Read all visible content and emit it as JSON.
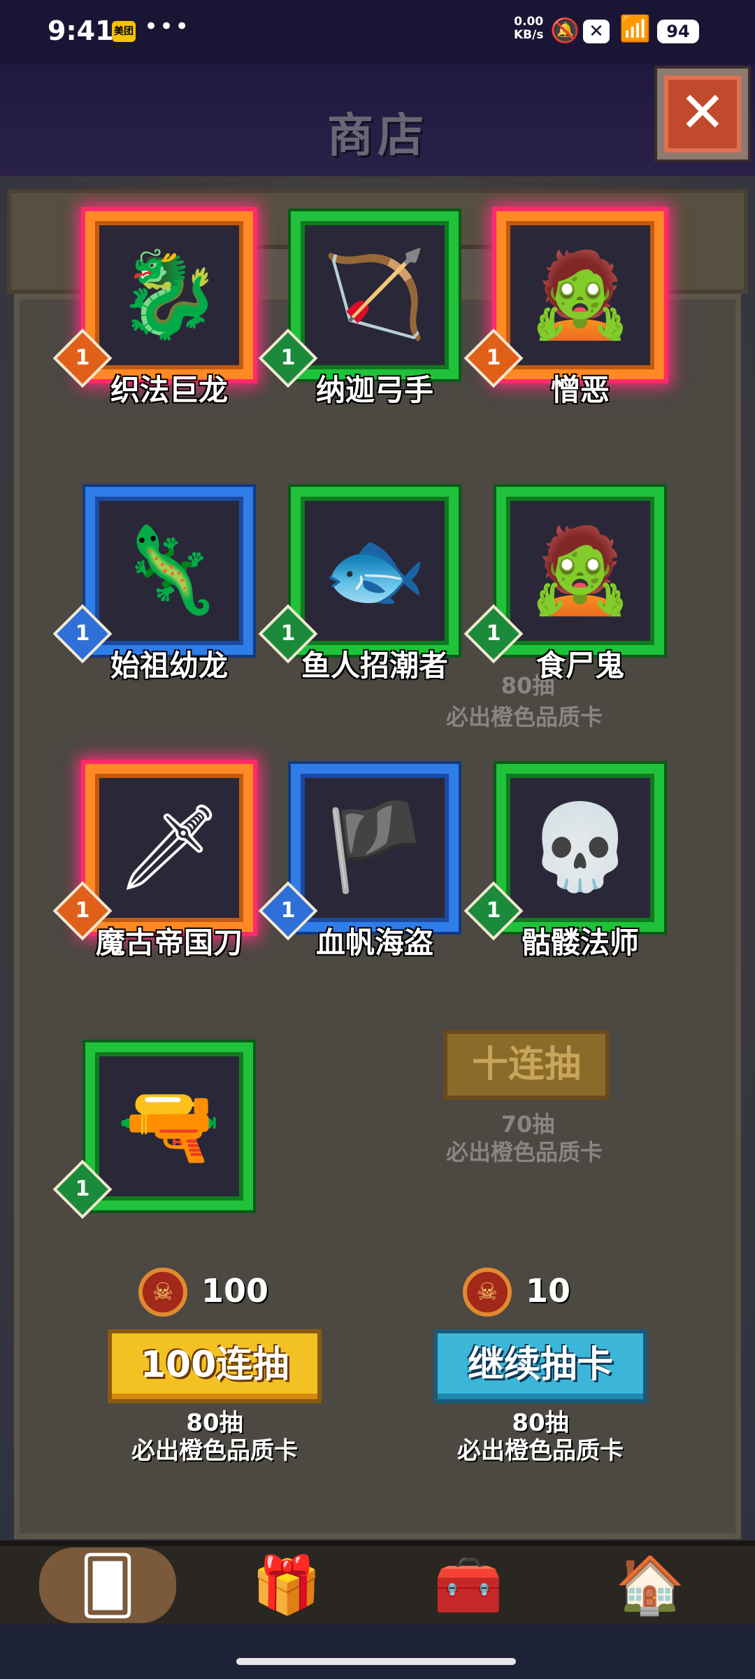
{
  "status_bar": {
    "time": "9:41",
    "app_badge": "美团",
    "dots": "•••",
    "net_speed_value": "0.00",
    "net_speed_unit": "KB/s",
    "battery": "94",
    "icons": [
      "bell-muted-icon",
      "close-box-icon",
      "wifi-icon",
      "battery-icon"
    ]
  },
  "header": {
    "title": "商店",
    "close_label": "✕"
  },
  "background_texts": {
    "reward_80": "80抽",
    "guarantee_80": "必出橙色品质卡",
    "ten_pull_label": "十连抽",
    "reward_70": "70抽",
    "guarantee_70": "必出橙色品质卡"
  },
  "cards": [
    {
      "name": "织法巨龙",
      "rarity": "orange",
      "level": "1",
      "icon": "blue-dragon-icon"
    },
    {
      "name": "纳迦弓手",
      "rarity": "green",
      "level": "1",
      "icon": "naga-archer-icon"
    },
    {
      "name": "憎恶",
      "rarity": "orange",
      "level": "1",
      "icon": "abomination-icon"
    },
    {
      "name": "始祖幼龙",
      "rarity": "blue",
      "level": "1",
      "icon": "whelp-icon"
    },
    {
      "name": "鱼人招潮者",
      "rarity": "green",
      "level": "1",
      "icon": "murloc-icon"
    },
    {
      "name": "食尸鬼",
      "rarity": "green",
      "level": "1",
      "icon": "ghoul-icon"
    },
    {
      "name": "魔古帝国刀",
      "rarity": "orange",
      "level": "1",
      "icon": "mogu-warrior-icon"
    },
    {
      "name": "血帆海盗",
      "rarity": "blue",
      "level": "1",
      "icon": "pirate-icon"
    },
    {
      "name": "骷髅法师",
      "rarity": "green",
      "level": "1",
      "icon": "skeleton-mage-icon"
    },
    {
      "name": "",
      "rarity": "green",
      "level": "1",
      "icon": "dwarf-rifleman-icon"
    }
  ],
  "pull_100": {
    "cost": "100",
    "label": "100连抽",
    "reward": "80抽",
    "guarantee": "必出橙色品质卡"
  },
  "pull_continue": {
    "cost": "10",
    "label": "继续抽卡",
    "reward": "80抽",
    "guarantee": "必出橙色品质卡"
  },
  "bottom_nav": [
    "card-deck-icon",
    "gift-icon",
    "treasure-chest-icon",
    "barracks-icon"
  ],
  "colors": {
    "orange": "#ff8a25",
    "green": "#1fc23a",
    "blue": "#2f7de8",
    "gold_button": "#f3c123",
    "cyan_button": "#3cb6d8"
  }
}
